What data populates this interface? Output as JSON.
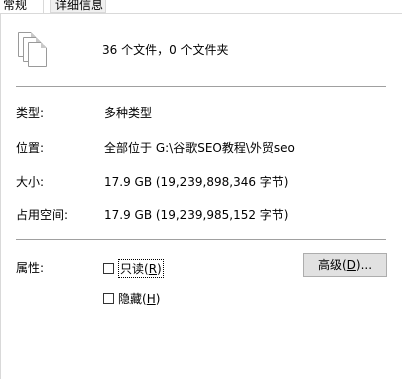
{
  "tabs": {
    "general": "常规",
    "details": "详细信息"
  },
  "summary": {
    "icon": "multiple-files-icon",
    "text": "36 个文件，0 个文件夹"
  },
  "properties": {
    "type_label": "类型:",
    "type_value": "多种类型",
    "location_label": "位置:",
    "location_value": "全部位于 G:\\谷歌SEO教程\\外贸seo",
    "size_label": "大小:",
    "size_value": "17.9 GB (19,239,898,346 字节)",
    "disk_label": "占用空间:",
    "disk_value": "17.9 GB (19,239,985,152 字节)"
  },
  "attributes": {
    "label": "属性:",
    "readonly_text": "只读(",
    "readonly_key": "R",
    "readonly_close": ")",
    "readonly_checked": false,
    "hidden_text": "隐藏(",
    "hidden_key": "H",
    "hidden_close": ")",
    "hidden_checked": false,
    "advanced_text": "高级(",
    "advanced_key": "D",
    "advanced_close": ")..."
  }
}
